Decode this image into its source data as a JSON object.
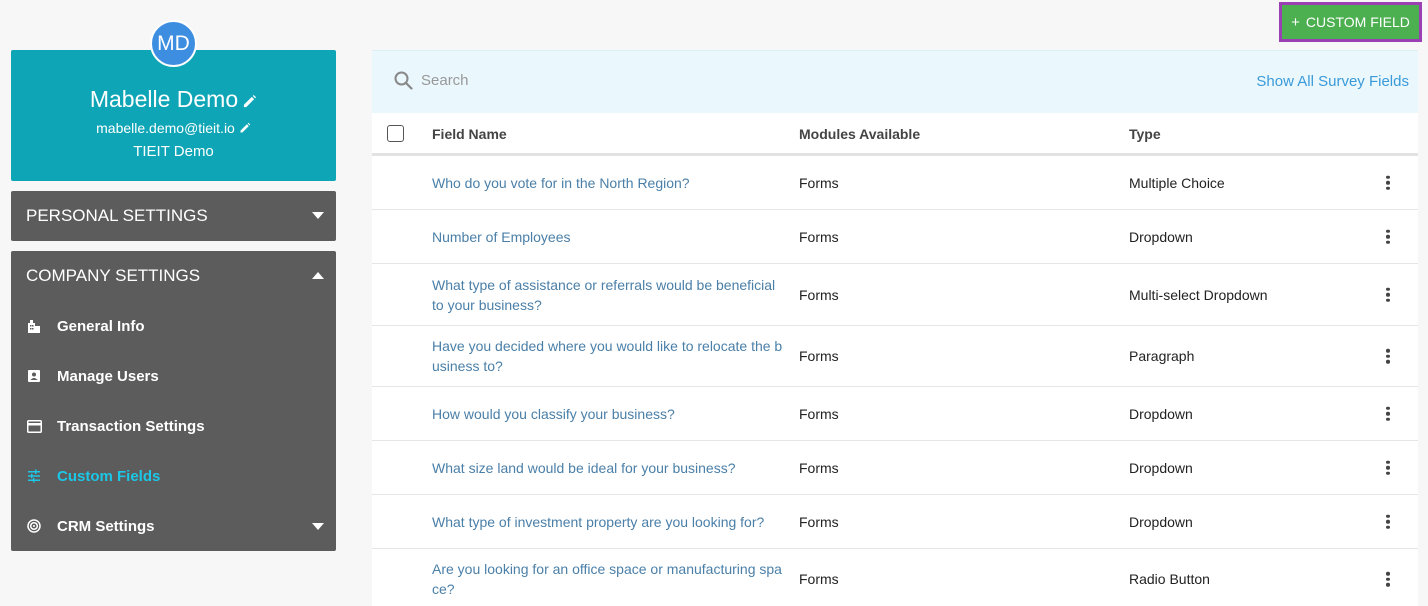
{
  "profile": {
    "initials": "MD",
    "name": "Mabelle Demo",
    "email": "mabelle.demo@tieit.io",
    "company": "TIEIT Demo"
  },
  "sidebar": {
    "personal_settings": "PERSONAL SETTINGS",
    "company_settings": "COMPANY SETTINGS",
    "items": [
      {
        "label": "General Info",
        "icon": "building-icon"
      },
      {
        "label": "Manage Users",
        "icon": "user-card-icon"
      },
      {
        "label": "Transaction Settings",
        "icon": "credit-card-icon"
      },
      {
        "label": "Custom Fields",
        "icon": "sliders-icon",
        "active": true
      },
      {
        "label": "CRM Settings",
        "icon": "target-icon"
      }
    ]
  },
  "toolbar": {
    "custom_field_label": "CUSTOM FIELD"
  },
  "search": {
    "placeholder": "Search",
    "show_all_label": "Show All Survey Fields"
  },
  "table": {
    "headers": {
      "field_name": "Field Name",
      "modules": "Modules Available",
      "type": "Type"
    },
    "rows": [
      {
        "name": "Who do you vote for in the North Region?",
        "module": "Forms",
        "type": "Multiple Choice"
      },
      {
        "name": "Number of Employees",
        "module": "Forms",
        "type": "Dropdown"
      },
      {
        "name": "What type of assistance or referrals would be beneficial to your business?",
        "module": "Forms",
        "type": "Multi-select Dropdown"
      },
      {
        "name": "Have you decided where you would like to relocate the business to?",
        "module": "Forms",
        "type": "Paragraph"
      },
      {
        "name": "How would you classify your business?",
        "module": "Forms",
        "type": "Dropdown"
      },
      {
        "name": "What size land would be ideal for your business?",
        "module": "Forms",
        "type": "Dropdown"
      },
      {
        "name": "What type of investment property are you looking for?",
        "module": "Forms",
        "type": "Dropdown"
      },
      {
        "name": "Are you looking for an office space or manufacturing space?",
        "module": "Forms",
        "type": "Radio Button"
      }
    ]
  },
  "colors": {
    "profile_bg": "#0ea5b6",
    "panel_bg": "#5c5c5c",
    "active_item": "#1cc6e6",
    "button_green": "#4caf50",
    "button_outline": "#9b3fb4",
    "link_blue": "#4a7fa8"
  }
}
